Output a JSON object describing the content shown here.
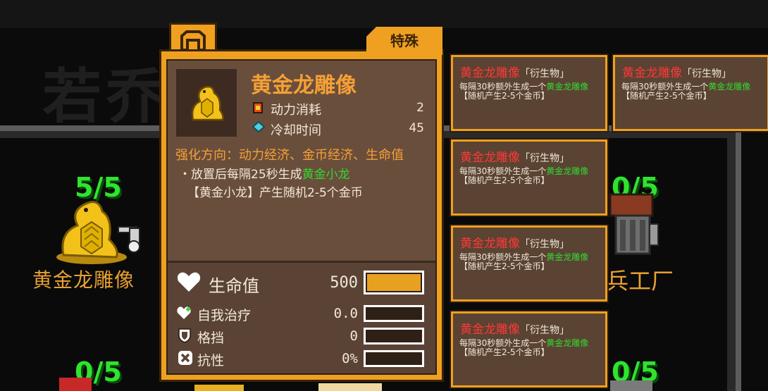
{
  "background": {
    "ghost_title": "若乔",
    "slots": [
      {
        "count": "5/5",
        "name": "黄金龙雕像"
      },
      {
        "count": "0/5",
        "name": "兵工厂"
      },
      {
        "count": "0/5"
      },
      {
        "count": "0/5"
      }
    ]
  },
  "tooltip": {
    "badge": "特殊",
    "item_name": "黄金龙雕像",
    "stats": [
      {
        "icon": "power-icon",
        "label": "动力消耗",
        "value": "2"
      },
      {
        "icon": "cooldown-icon",
        "label": "冷却时间",
        "value": "45"
      }
    ],
    "upgrade_direction": "强化方向：动力经济、金币经济、生命值",
    "description": {
      "line1_prefix": "・放置后每隔25秒生成",
      "line1_highlight": "黄金小龙",
      "line2": "【黄金小龙】产生随机2-5个金币"
    },
    "bars": [
      {
        "icon": "heart-icon",
        "label": "生命值",
        "value": "500",
        "fill": 1.0
      },
      {
        "icon": "heal-icon",
        "label": "自我治疗",
        "value": "0.0",
        "fill": 0.0
      },
      {
        "icon": "shield-icon",
        "label": "格挡",
        "value": "0",
        "fill": 0.0
      },
      {
        "icon": "resist-icon",
        "label": "抗性",
        "value": "0%",
        "fill": 0.0
      }
    ]
  },
  "derivatives": [
    {
      "name": "黄金龙雕像",
      "tag": "「衍生物」",
      "desc_prefix": "每隔30秒额外生成一个",
      "desc_highlight": "黄金龙雕像",
      "desc_suffix": "【随机产生2-5个金币】"
    },
    {
      "name": "黄金龙雕像",
      "tag": "「衍生物」",
      "desc_prefix": "每隔30秒额外生成一个",
      "desc_highlight": "黄金龙雕像",
      "desc_suffix": "【随机产生2-5个金币】"
    },
    {
      "name": "黄金龙雕像",
      "tag": "「衍生物」",
      "desc_prefix": "每隔30秒额外生成一个",
      "desc_highlight": "黄金龙雕像",
      "desc_suffix": "【随机产生2-5个金币】"
    },
    {
      "name": "黄金龙雕像",
      "tag": "「衍生物」",
      "desc_prefix": "每隔30秒额外生成一个",
      "desc_highlight": "黄金龙雕像",
      "desc_suffix": "【随机产生2-5个金币】"
    },
    {
      "name": "黄金龙雕像",
      "tag": "「衍生物」",
      "desc_prefix": "每隔30秒额外生成一个",
      "desc_highlight": "黄金龙雕像",
      "desc_suffix": "【随机产生2-5个金币】"
    }
  ],
  "colors": {
    "card_border": "#f0a020",
    "title_orange": "#f5a035",
    "highlight_green": "#32d832",
    "derivative_name_red": "#ff3838",
    "count_green": "#2fe32f"
  }
}
